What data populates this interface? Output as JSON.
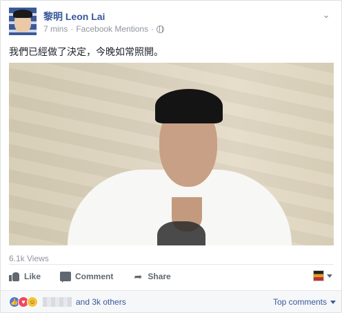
{
  "post": {
    "author": "黎明 Leon Lai",
    "time": "7 mins",
    "separator": "·",
    "source": "Facebook Mentions",
    "text": "我們已經做了決定，今晚如常照開。",
    "views": "6.1k Views"
  },
  "actions": {
    "like": "Like",
    "comment": "Comment",
    "share": "Share"
  },
  "reactions": {
    "others": "and 3k others",
    "sort": "Top comments",
    "types": [
      "like-icon",
      "love-icon",
      "haha-icon"
    ]
  },
  "colors": {
    "link": "#365899",
    "meta": "#90949c",
    "action": "#606770"
  }
}
